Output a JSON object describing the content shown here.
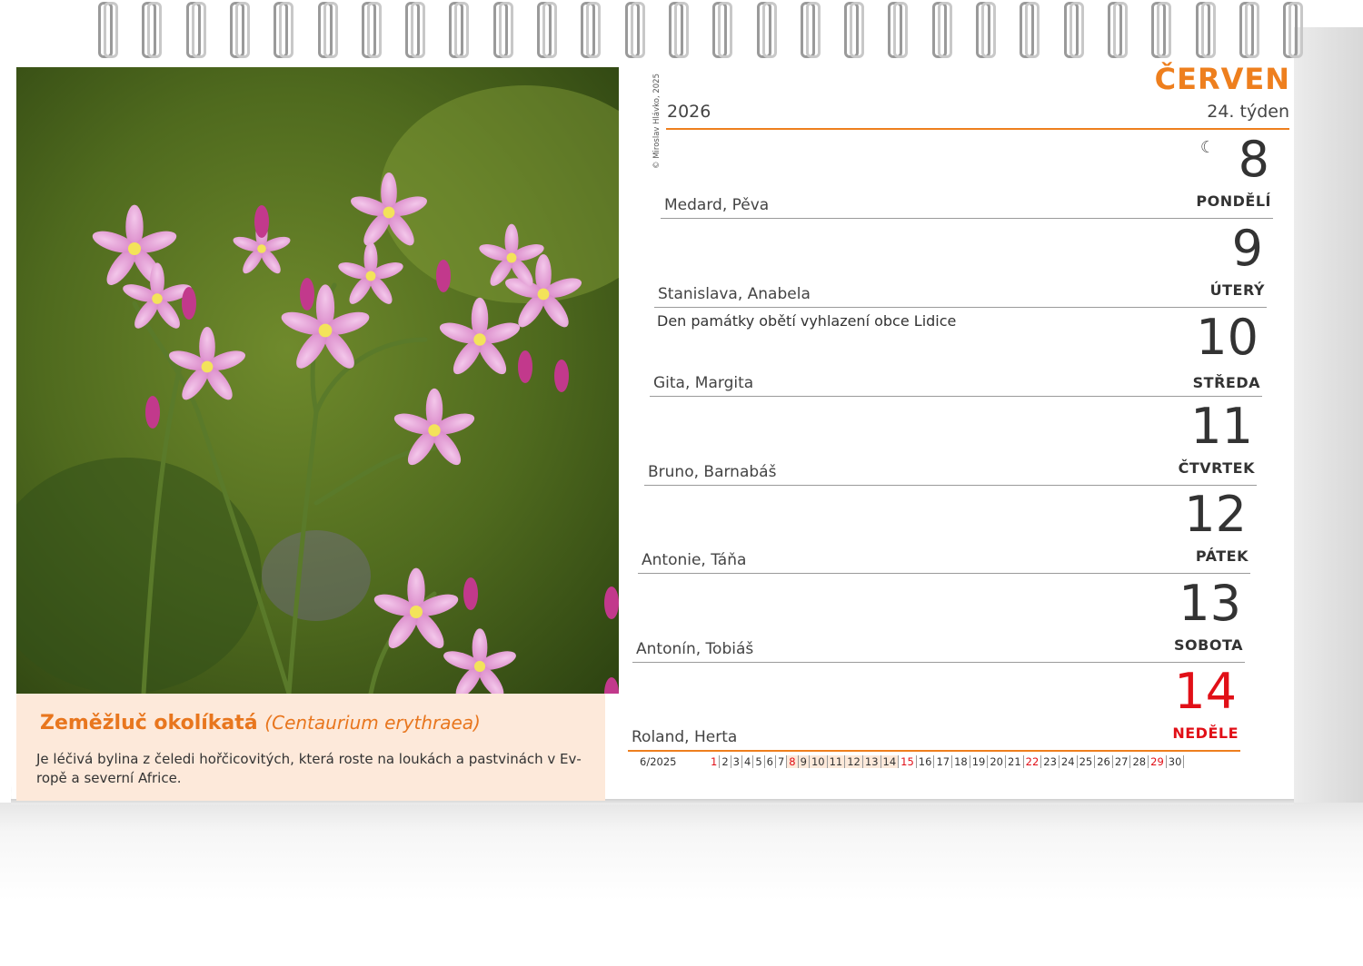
{
  "photo": {
    "credit": "© Miroslav Hlávko, 2025",
    "caption_title": "Zeměžluč okolíkatá",
    "caption_latin": "(Centaurium erythraea)",
    "caption_text": "Je léčivá bylina z čeledi hořčicovitých, která roste na loukách a pastvinách v Ev­ropě a severní Africe."
  },
  "header": {
    "month": "ČERVEN",
    "year": "2026",
    "week": "24. týden"
  },
  "days": [
    {
      "number": "8",
      "weekday": "PONDĚLÍ",
      "names": "Medard, Pěva",
      "holiday": "",
      "moon": "☾"
    },
    {
      "number": "9",
      "weekday": "ÚTERÝ",
      "names": "Stanislava, Anabela",
      "holiday": ""
    },
    {
      "number": "10",
      "weekday": "STŘEDA",
      "names": "Gita, Margita",
      "holiday": "Den památky obětí vyhlazení obce Lidice"
    },
    {
      "number": "11",
      "weekday": "ČTVRTEK",
      "names": "Bruno, Barnabáš",
      "holiday": ""
    },
    {
      "number": "12",
      "weekday": "PÁTEK",
      "names": "Antonie, Táňa",
      "holiday": ""
    },
    {
      "number": "13",
      "weekday": "SOBOTA",
      "names": "Antonín, Tobiáš",
      "holiday": ""
    },
    {
      "number": "14",
      "weekday": "NEDĚLE",
      "names": "Roland, Herta",
      "holiday": ""
    }
  ],
  "mini_calendar": {
    "label": "6/2025",
    "days": [
      "1",
      "2",
      "3",
      "4",
      "5",
      "6",
      "7",
      "8",
      "9",
      "10",
      "11",
      "12",
      "13",
      "14",
      "15",
      "16",
      "17",
      "18",
      "19",
      "20",
      "21",
      "22",
      "23",
      "24",
      "25",
      "26",
      "27",
      "28",
      "29",
      "30"
    ],
    "sundays": [
      "1",
      "8",
      "15",
      "22",
      "29"
    ],
    "current_week": [
      "8",
      "9",
      "10",
      "11",
      "12",
      "13",
      "14"
    ]
  },
  "colors": {
    "accent_orange": "#ee7f1e",
    "sunday_red": "#e10f17",
    "caption_bg": "#fde9da"
  }
}
